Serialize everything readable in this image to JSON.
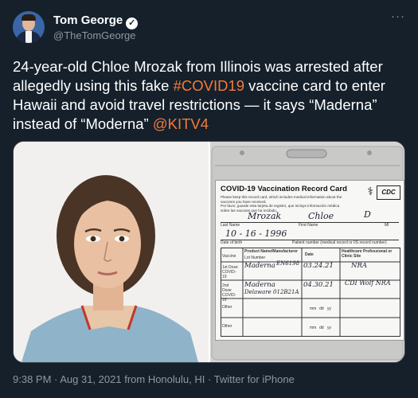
{
  "author": {
    "name": "Tom George",
    "handle": "@TheTomGeorge",
    "verified_icon": "verified-badge-icon",
    "more_icon": "more-options-icon"
  },
  "tweet": {
    "text_1": "24-year-old Chloe Mrozak from Illinois was arrested after allegedly using this fake ",
    "hashtag": "#COVID19",
    "text_2": " vaccine card to enter Hawaii and avoid travel restrictions — it says “Maderna” instead of “Moderna” ",
    "mention": "@KITV4"
  },
  "card": {
    "title": "COVID-19 Vaccination Record Card",
    "small_en": "Please keep this record card, which includes medical information about the vaccines you have received.",
    "small_es": "Por favor, guarde esta tarjeta de registro, que incluye información médica sobre las vacunas que ha recibido.",
    "cdc": "CDC",
    "last_name": "Mrozak",
    "first_name": "Chloe",
    "mi": "D",
    "label_last": "Last Name",
    "label_first": "First Name",
    "label_mi": "MI",
    "dob": "10 - 16 - 1996",
    "label_dob": "Date of birth",
    "label_patient": "Patient number (medical record or IIS record number)",
    "col_vaccine": "Vaccine",
    "col_product": "Product Name/Manufacturer",
    "col_lot": "Lot Number",
    "col_date": "Date",
    "col_site": "Healthcare Professional or Clinic Site",
    "row1_label": "1st Dose COVID-19",
    "row1_product": "Maderna",
    "row1_lot": "EN6198",
    "row1_date": "03.24.21",
    "row1_site": "NRA",
    "row2_label": "2nd Dose COVID-19",
    "row2_product": "Maderna",
    "row2_lot": "Delaware 012B21A",
    "row2_date": "04.30.21",
    "row2_site": "CDI Wolf NRA",
    "row3_label": "Other",
    "row4_label": "Other",
    "mm": "mm",
    "dd": "dd",
    "yy": "yy"
  },
  "footer": {
    "text": "9:38 PM · Aug 31, 2021 from Honolulu, HI · Twitter for iPhone"
  },
  "colors": {
    "background": "#15202b",
    "link": "#f47a3a",
    "muted": "#8b98a5"
  }
}
